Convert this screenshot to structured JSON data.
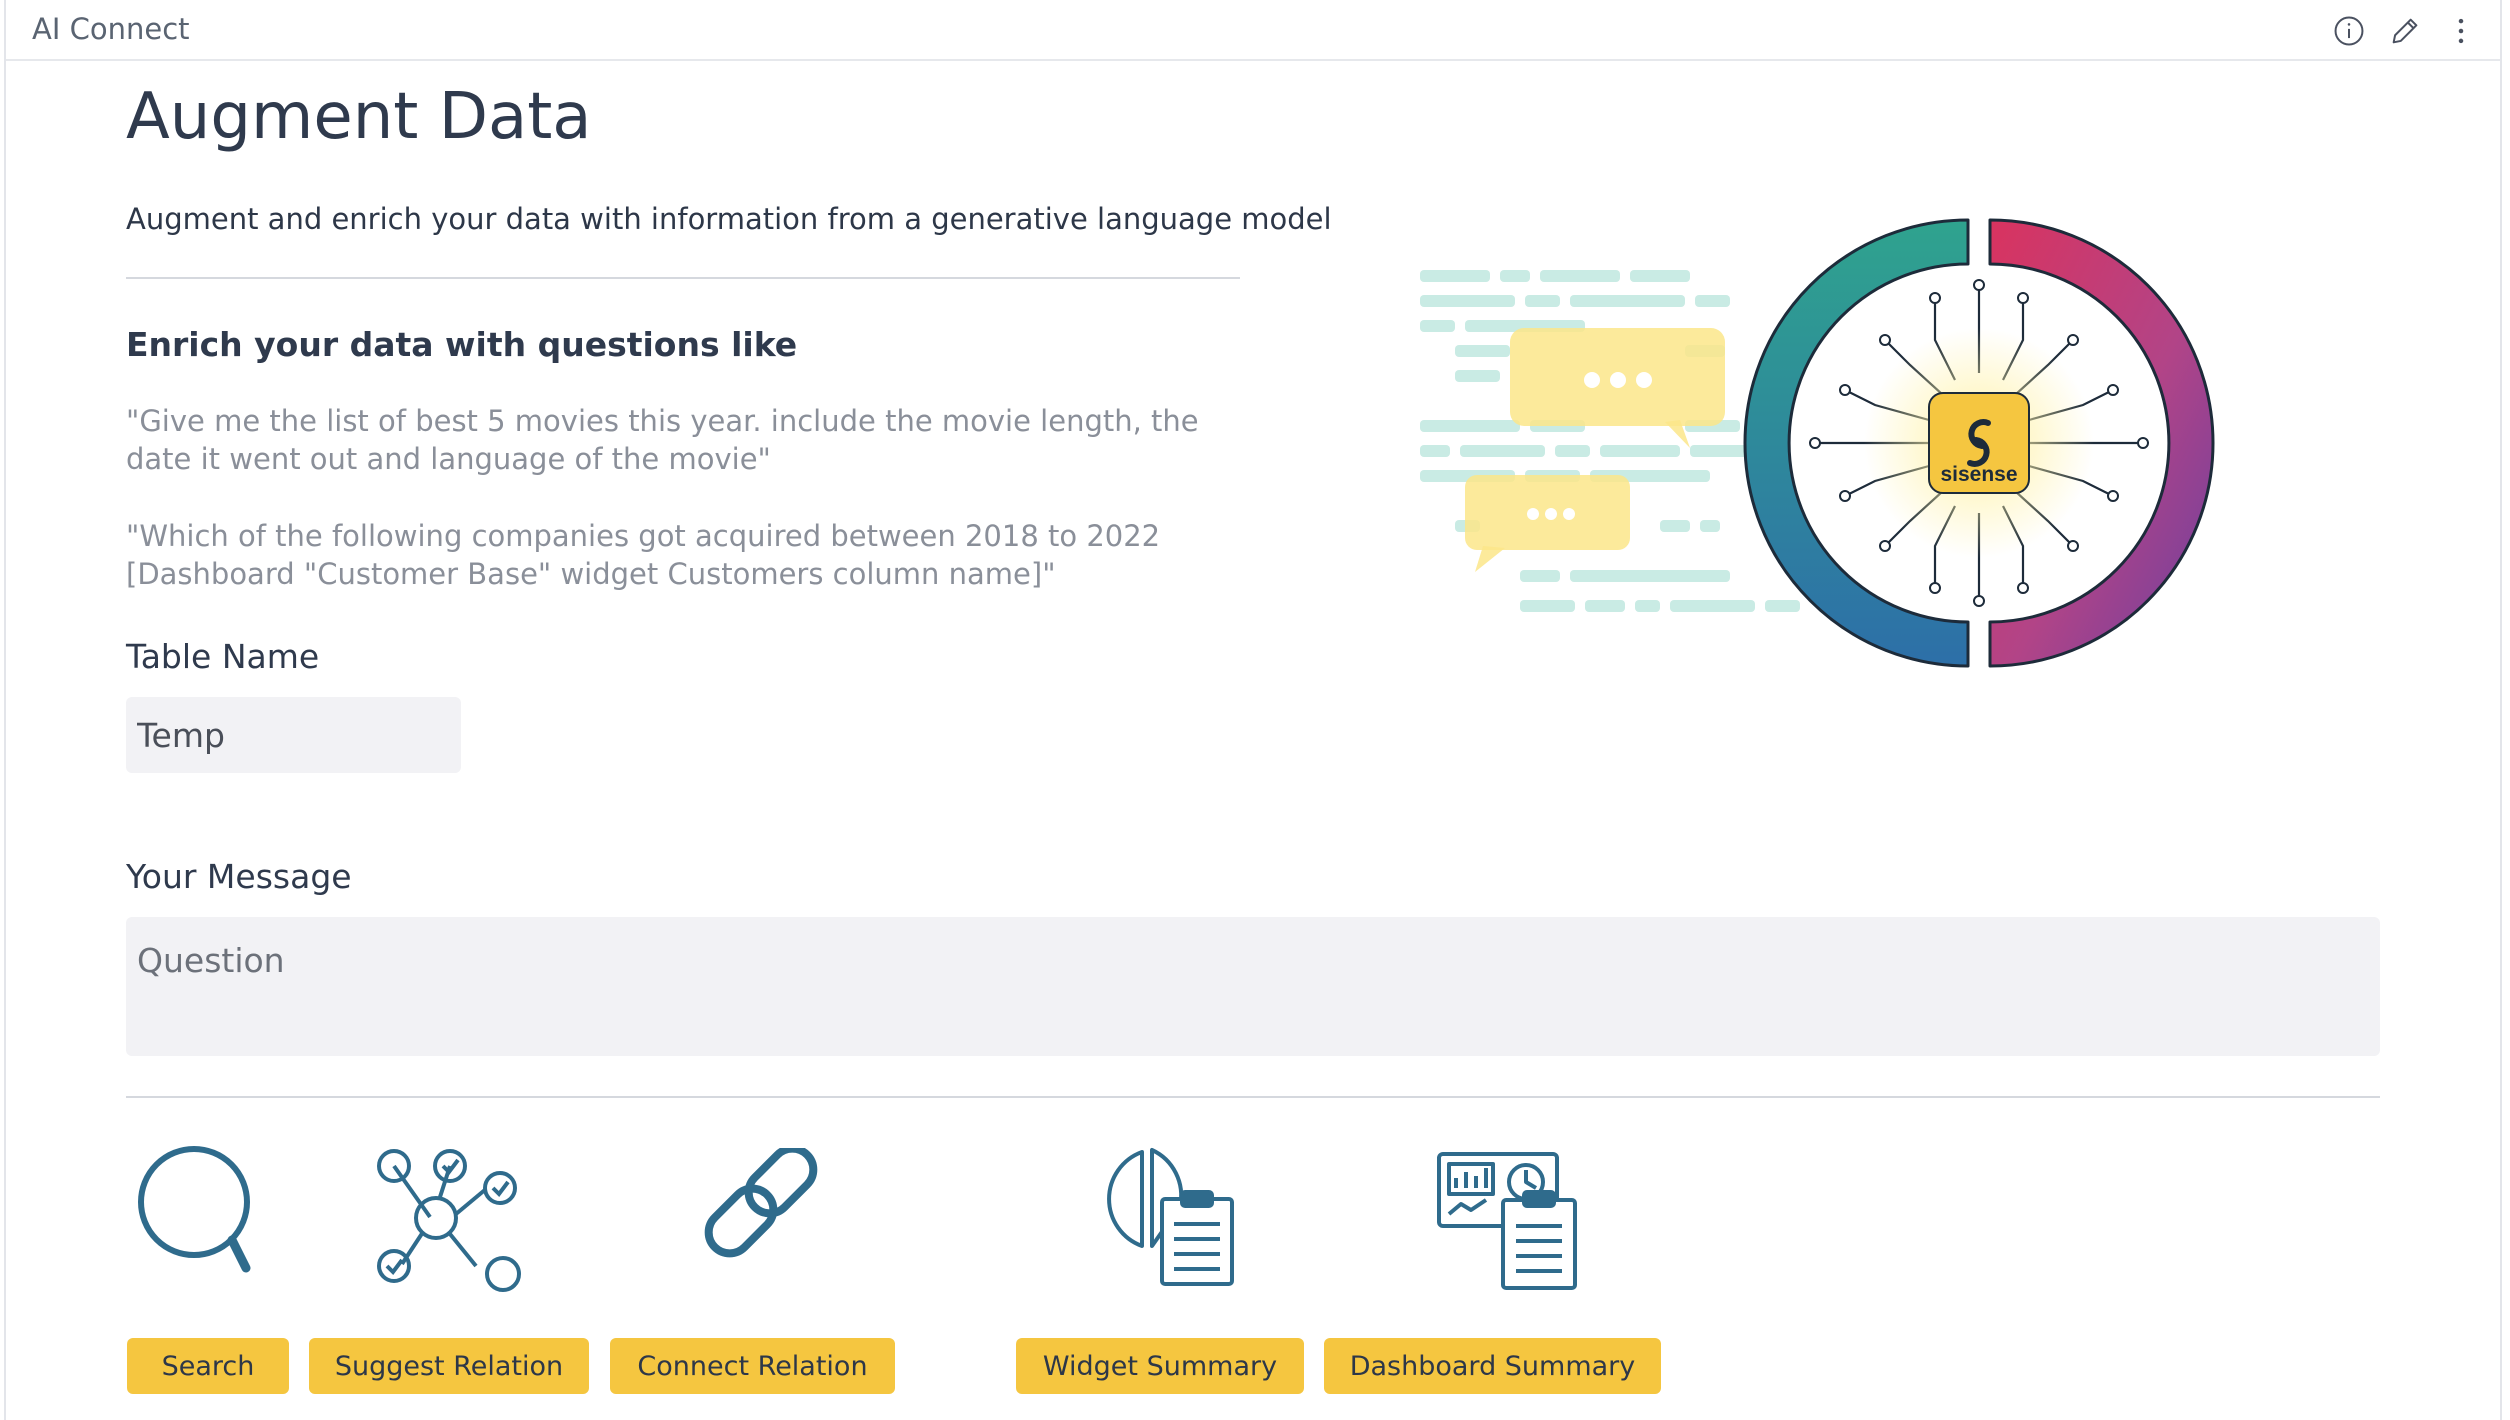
{
  "header": {
    "title": "AI Connect"
  },
  "main": {
    "title": "Augment Data",
    "subtitle": "Augment and enrich your data with information from a generative language model",
    "examples_heading": "Enrich your data with questions like",
    "examples": [
      "\"Give me the list of best 5 movies this year. include the movie length, the date it went out and language of the movie\"",
      "\"Which of the following companies got acquired between 2018 to 2022 [Dashboard \"Customer Base\" widget Customers column name]\""
    ],
    "table_name": {
      "label": "Table Name",
      "value": "Temp"
    },
    "message": {
      "label": "Your Message",
      "placeholder": "Question"
    }
  },
  "hero": {
    "brand_text": "sisense"
  },
  "actions": [
    {
      "label": "Search",
      "icon": "search-icon"
    },
    {
      "label": "Suggest Relation",
      "icon": "network-nodes-icon"
    },
    {
      "label": "Connect Relation",
      "icon": "chain-link-icon"
    },
    {
      "label": "Widget Summary",
      "icon": "pie-chart-clipboard-icon"
    },
    {
      "label": "Dashboard Summary",
      "icon": "dashboard-clipboard-icon"
    }
  ],
  "colors": {
    "accent": "#f5c640",
    "icon": "#2f6b8c",
    "text": "#2f3a4d"
  }
}
